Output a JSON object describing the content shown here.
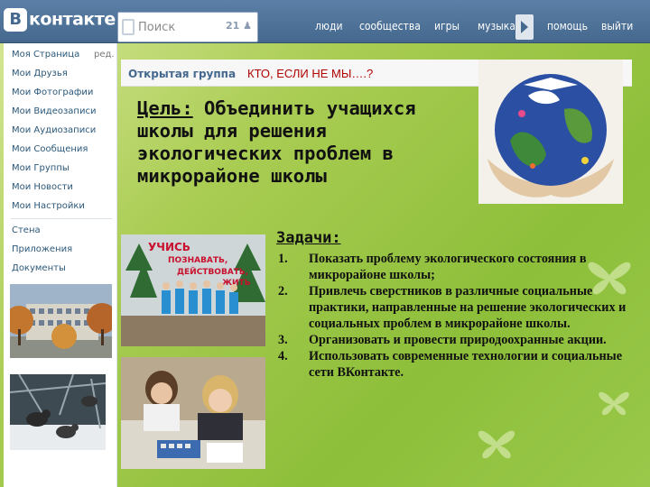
{
  "header": {
    "logo_letter": "В",
    "logo_text": "контакте",
    "search": {
      "placeholder": "Поиск",
      "count": "21"
    },
    "nav": [
      "люди",
      "сообщества",
      "игры",
      "музыка",
      "помощь",
      "выйти"
    ]
  },
  "sidebar": {
    "edit_label": "ред.",
    "items": [
      "Моя Страница",
      "Мои Друзья",
      "Мои Фотографии",
      "Мои Видеозаписи",
      "Мои Аудиозаписи",
      "Мои Сообщения",
      "Мои Группы",
      "Мои Новости",
      "Мои Настройки"
    ],
    "items2": [
      "Стена",
      "Приложения",
      "Документы"
    ]
  },
  "group": {
    "type_label": "Открытая группа",
    "title": "КТО, ЕСЛИ НЕ МЫ….?"
  },
  "goal": {
    "label": "Цель:",
    "text": " Объединить учащихся школы для решения экологических проблем в микрорайоне школы"
  },
  "tasks": {
    "heading": "Задачи:",
    "items": [
      {
        "num": "1.",
        "text": "Показать проблему экологического состояния в микрорайоне школы;"
      },
      {
        "num": "2.",
        "text": "Привлечь сверстников в различные социальные практики, направленные на решение экологических и социальных проблем в микрорайоне школы."
      },
      {
        "num": "3.",
        "text": "Организовать и провести природоохранные акции."
      },
      {
        "num": "4.",
        "text": "Использовать современные технологии и социальные сети ВКонтакте."
      }
    ]
  },
  "poster": {
    "line1": "УЧИСЬ",
    "line2": "ПОЗНАВАТЬ,",
    "line3": "ДЕЙСТВОВАТЬ,",
    "line4": "ЖИТЬ"
  },
  "colors": {
    "vk_blue": "#45688e",
    "link": "#2b587a",
    "title_red": "#b00000",
    "background_green": "#a9cc52"
  }
}
